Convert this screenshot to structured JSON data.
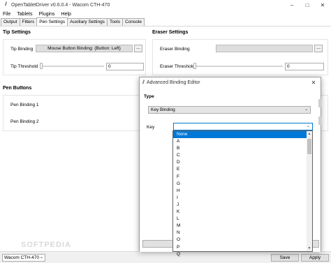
{
  "window": {
    "title": "OpenTabletDriver v0.6.0.4 - Wacom CTH-470",
    "icon": "otd-logo-icon"
  },
  "menu": [
    "File",
    "Tablets",
    "Plugins",
    "Help"
  ],
  "tabs": [
    "Output",
    "Filters",
    "Pen Settings",
    "Auxiliary Settings",
    "Tools",
    "Console"
  ],
  "active_tab": "Pen Settings",
  "tip_settings": {
    "title": "Tip Settings",
    "binding_label": "Tip Binding",
    "binding_value": "Mouse Button Binding: {Button: Left}",
    "more_label": "...",
    "threshold_label": "Tip Threshold",
    "threshold_value": "0"
  },
  "eraser_settings": {
    "title": "Eraser Settings",
    "binding_label": "Eraser Binding",
    "binding_value": "",
    "more_label": "...",
    "threshold_label": "Eraser Threshold",
    "threshold_value": "0"
  },
  "pen_buttons": {
    "title": "Pen Buttons",
    "items": [
      "Pen Binding 1",
      "Pen Binding 2"
    ]
  },
  "statusbar": {
    "tablet_select": "Wacom CTH-470",
    "save_label": "Save",
    "apply_label": "Apply"
  },
  "dialog": {
    "title": "Advanced Binding Editor",
    "type_label": "Type",
    "type_value": "Key Binding",
    "key_label": "Key",
    "key_value": "",
    "options": [
      "None",
      "A",
      "B",
      "C",
      "D",
      "E",
      "F",
      "G",
      "H",
      "I",
      "J",
      "K",
      "L",
      "M",
      "N",
      "O",
      "P",
      "Q"
    ],
    "selected_option": "None"
  },
  "watermark": "SOFTPEDIA"
}
